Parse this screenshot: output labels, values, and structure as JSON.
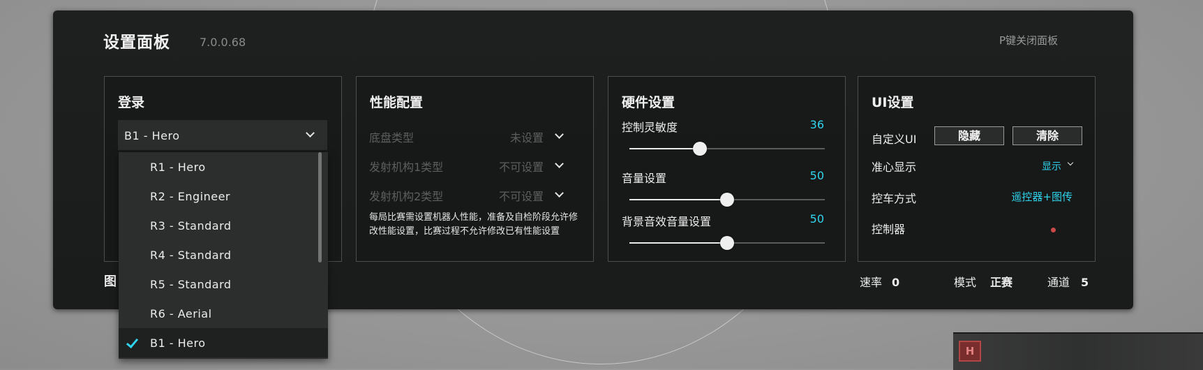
{
  "panel": {
    "title": "设置面板",
    "version": "7.0.0.68",
    "close_hint": "P键关闭面板"
  },
  "login": {
    "title": "登录",
    "selected": "B1 - Hero",
    "options": [
      "R1 - Hero",
      "R2 - Engineer",
      "R3 - Standard",
      "R4 - Standard",
      "R5 - Standard",
      "R6 - Aerial",
      "B1 - Hero"
    ],
    "checked_option": "B1 - Hero"
  },
  "performance": {
    "title": "性能配置",
    "rows": [
      {
        "label": "底盘类型",
        "value": "未设置"
      },
      {
        "label": "发射机构1类型",
        "value": "不可设置"
      },
      {
        "label": "发射机构2类型",
        "value": "不可设置"
      }
    ],
    "note": "每局比赛需设置机器人性能，准备及自检阶段允许修改性能设置，比赛过程不允许修改已有性能设置"
  },
  "hardware": {
    "title": "硬件设置",
    "sliders": [
      {
        "label": "控制灵敏度",
        "value": "36",
        "fraction": 0.36
      },
      {
        "label": "音量设置",
        "value": "50",
        "fraction": 0.5
      },
      {
        "label": "背景音效音量设置",
        "value": "50",
        "fraction": 0.5
      }
    ]
  },
  "ui_settings": {
    "title": "UI设置",
    "custom_ui_label": "自定义UI",
    "hide_button": "隐藏",
    "clear_button": "清除",
    "crosshair_label": "准心显示",
    "crosshair_value": "显示",
    "control_mode_label": "控车方式",
    "control_mode_value": "遥控器+图传",
    "controller_label": "控制器",
    "controller_status_color": "#c94848"
  },
  "footer": {
    "left_text": "图",
    "rate_label": "速率",
    "rate_value": "0",
    "mode_label": "模式",
    "mode_value": "正赛",
    "channel_label": "通道",
    "channel_value": "5"
  },
  "robot_badge": "H",
  "colors": {
    "accent": "#2fd5ee",
    "panel_bg": "#1e2020",
    "status_red": "#c94848"
  }
}
